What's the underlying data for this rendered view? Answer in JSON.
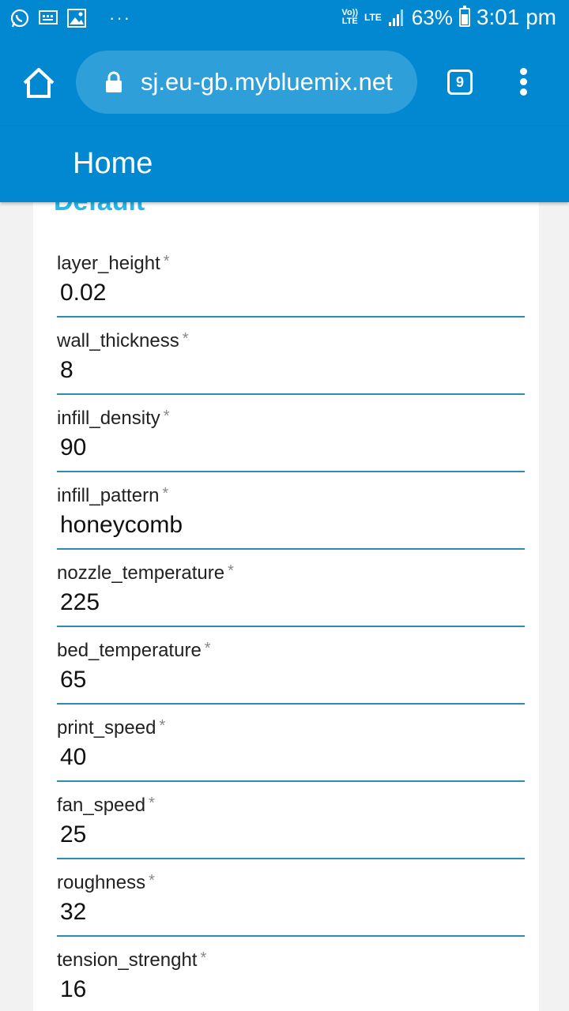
{
  "status_bar": {
    "icons": [
      "whatsapp-icon",
      "message-icon",
      "gallery-icon"
    ],
    "more": "···",
    "volte": "Vo))\nLTE",
    "network": "LTE",
    "battery_pct": "63%",
    "battery_level": 0.63,
    "time": "3:01 pm"
  },
  "browser": {
    "url": "sj.eu-gb.mybluemix.net",
    "tab_count": "9"
  },
  "header": {
    "title": "Home"
  },
  "form": {
    "section_title": "Default",
    "required_mark": "*",
    "fields": [
      {
        "label": "layer_height",
        "value": "0.02"
      },
      {
        "label": "wall_thickness",
        "value": "8"
      },
      {
        "label": "infill_density",
        "value": "90"
      },
      {
        "label": "infill_pattern",
        "value": "honeycomb"
      },
      {
        "label": "nozzle_temperature",
        "value": "225"
      },
      {
        "label": "bed_temperature",
        "value": "65"
      },
      {
        "label": "print_speed",
        "value": "40"
      },
      {
        "label": "fan_speed",
        "value": "25"
      },
      {
        "label": "roughness",
        "value": "32"
      },
      {
        "label": "tension_strenght",
        "value": "16"
      }
    ]
  },
  "colors": {
    "primary": "#0288d1",
    "url_bar": "#2f9fda",
    "section_title": "#29b6e8",
    "underline": "#2a8db3"
  }
}
